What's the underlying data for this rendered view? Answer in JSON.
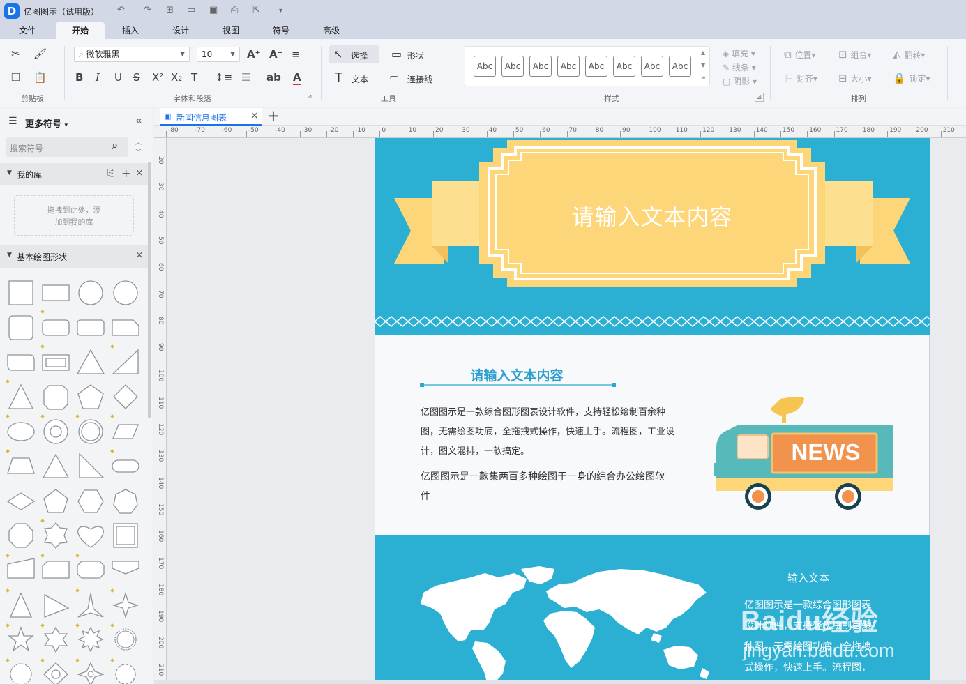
{
  "app": {
    "title": "亿图图示（试用版）",
    "logo_letter": "D"
  },
  "menu": {
    "tabs": [
      "文件",
      "开始",
      "插入",
      "设计",
      "视图",
      "符号",
      "高级"
    ],
    "active": "开始"
  },
  "ribbon": {
    "font_name": "微软雅黑",
    "font_size": "10",
    "select_label": "选择",
    "shape_label": "形状",
    "text_label": "文本",
    "connector_label": "连接线",
    "style_samples": [
      "Abc",
      "Abc",
      "Abc",
      "Abc",
      "Abc",
      "Abc",
      "Abc",
      "Abc"
    ],
    "fill_label": "填充",
    "line_label": "线条",
    "shadow_label": "阴影",
    "position_label": "位置",
    "group_label": "组合",
    "flip_label": "翻转",
    "align_label": "对齐",
    "size_label": "大小",
    "lock_label": "锁定",
    "groups": {
      "clipboard": "剪贴板",
      "font": "字体和段落",
      "tools": "工具",
      "styles": "样式",
      "arrange": "排列"
    }
  },
  "sidebar": {
    "title": "更多符号",
    "search_placeholder": "搜索符号",
    "my_library": "我的库",
    "drop_hint_1": "拖拽到此处，添",
    "drop_hint_2": "加到我的库",
    "basic_shapes": "基本绘图形状"
  },
  "document": {
    "tab": "新闻信息图表"
  },
  "rulers": {
    "h": [
      "-80",
      "-70",
      "-60",
      "-50",
      "-40",
      "-30",
      "-20",
      "-10",
      "0",
      "10",
      "20",
      "30",
      "40",
      "50",
      "60",
      "70",
      "80",
      "90",
      "100",
      "110",
      "120",
      "130",
      "140",
      "150",
      "160",
      "170",
      "180",
      "190",
      "200",
      "210",
      "220"
    ],
    "v": [
      "20",
      "30",
      "40",
      "50",
      "60",
      "70",
      "80",
      "90",
      "100",
      "110",
      "120",
      "130",
      "140",
      "150",
      "160",
      "170",
      "180",
      "190",
      "200",
      "210"
    ]
  },
  "page": {
    "banner_text": "请输入文本内容",
    "heading": "请输入文本内容",
    "para1_lines": [
      "亿图图示是一款综合图形图表设计软件，支持轻松绘制百余种",
      "图，无需绘图功底，全拖拽式操作，快速上手。流程图，工业设",
      "计，图文混排，一软搞定。"
    ],
    "para2_lines": [
      "亿图图示是一款集两百多种绘图于一身的综合办公绘图软",
      "件"
    ],
    "news_label": "NEWS",
    "input_text": "输入文本",
    "world_lines": [
      "亿图图示是一款综合图形图表",
      "设计软件，支持轻松绘制百余",
      "种图，无需绘图功底，全拖拽",
      "式操作，快速上手。流程图，"
    ]
  },
  "watermark": {
    "main": "Baidu经验",
    "url": "jingyan.baidu.com"
  },
  "colors": {
    "accent": "#1a73e8",
    "banner_blue": "#2bafd3",
    "banner_yellow": "#ffd778",
    "news_orange": "#f2934d",
    "truck_teal": "#57b9b9"
  }
}
